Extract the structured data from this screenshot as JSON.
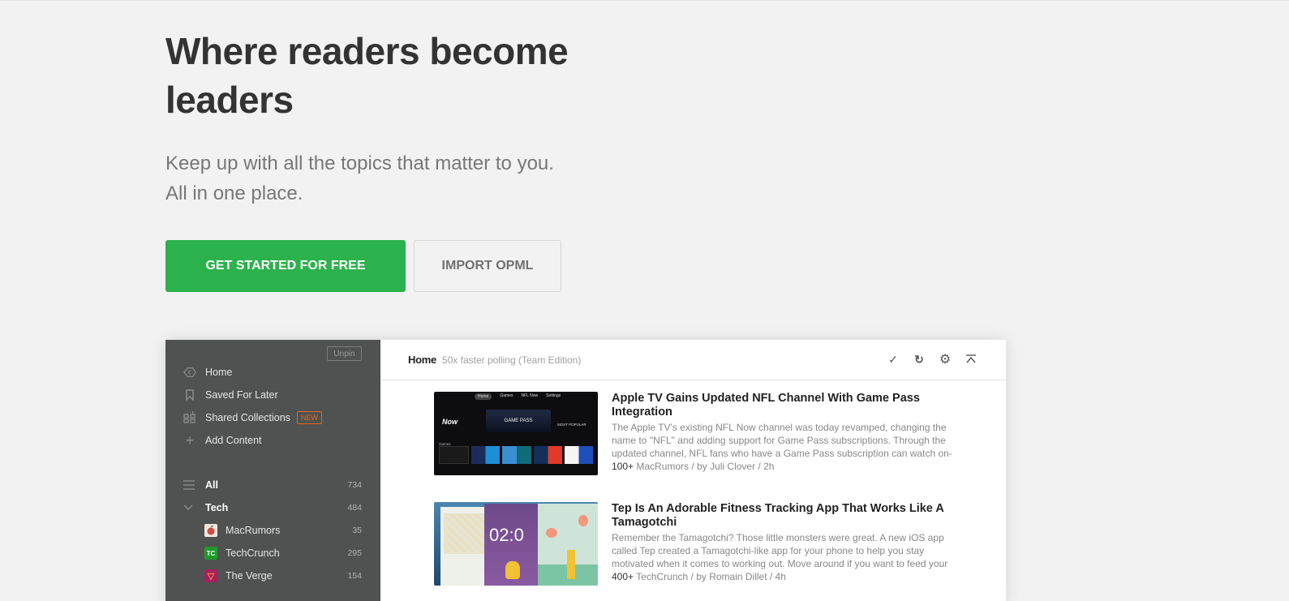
{
  "hero": {
    "title": "Where readers become leaders",
    "subtitle_line1": "Keep up with all the topics that matter to you.",
    "subtitle_line2": "All in one place.",
    "primary_button": "GET STARTED FOR FREE",
    "secondary_button": "IMPORT OPML"
  },
  "colors": {
    "brand_green": "#2bb24c",
    "sidebar_bg": "#4f5250",
    "new_badge": "#e8641c"
  },
  "sidebar": {
    "unpin_label": "Unpin",
    "nav": [
      {
        "label": "Home",
        "icon": "home-icon"
      },
      {
        "label": "Saved For Later",
        "icon": "bookmark-icon"
      },
      {
        "label": "Shared Collections",
        "icon": "collections-icon",
        "badge": "NEW"
      },
      {
        "label": "Add Content",
        "icon": "plus-icon"
      }
    ],
    "all": {
      "label": "All",
      "count": "734",
      "icon": "list-icon"
    },
    "category": {
      "label": "Tech",
      "count": "484",
      "icon": "chevron-down-icon"
    },
    "feeds": [
      {
        "label": "MacRumors",
        "count": "35",
        "icon": "macrumors-favicon",
        "fav_text": ""
      },
      {
        "label": "TechCrunch",
        "count": "295",
        "icon": "techcrunch-favicon",
        "fav_text": "TC"
      },
      {
        "label": "The Verge",
        "count": "154",
        "icon": "verge-favicon",
        "fav_text": "▽"
      }
    ]
  },
  "main": {
    "title": "Home",
    "subtitle": "50x faster polling (Team Edition)",
    "tools": [
      {
        "name": "mark-read-icon",
        "glyph": "✓"
      },
      {
        "name": "refresh-icon",
        "glyph": "↻"
      },
      {
        "name": "settings-gear-icon",
        "glyph": "⚙"
      },
      {
        "name": "collapse-top-icon",
        "glyph": "⌅"
      }
    ],
    "articles": [
      {
        "title": "Apple TV Gains Updated NFL Channel With Game Pass Integration",
        "summary": "The Apple TV's existing NFL Now channel was today revamped, changing the name to \"NFL\" and adding support for Game Pass subscriptions. Through the updated channel, NFL fans who have a Game Pass subscription can watch on-",
        "popularity": "100+",
        "meta": "MacRumors / by Juli Clover / 2h",
        "thumb_tabs": [
          "Home",
          "Games",
          "NFL Now",
          "Settings"
        ],
        "thumb_labels": {
          "now": "Now",
          "gamepass": "GAME PASS",
          "popular": "MOST POPULAR",
          "games": "Games"
        }
      },
      {
        "title": "Tep Is An Adorable Fitness Tracking App That Works Like A Tamagotchi",
        "summary": "Remember the Tamagotchi? Those little monsters were great. A new iOS app called Tep created a Tamagotchi-like app for your phone to help you stay motivated when it comes to working out. Move around if you want to feed your",
        "popularity": "400+",
        "meta": "TechCrunch / by Romain Dillet / 4h",
        "thumb_labels": {
          "clock": "02:0"
        }
      }
    ]
  }
}
